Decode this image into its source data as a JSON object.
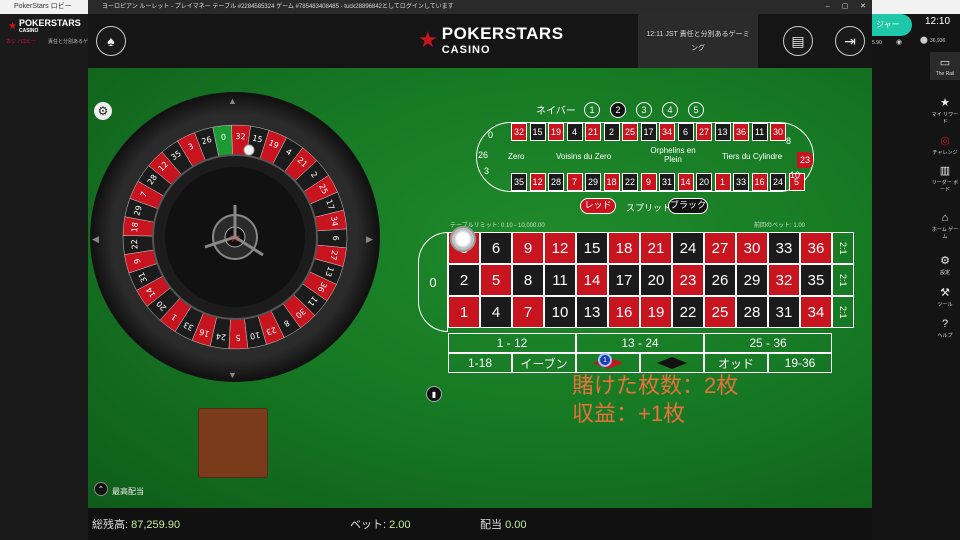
{
  "outer_app": {
    "title": "PokerStars ロビー",
    "logo": "POKERSTARS",
    "logo_sub": "CASINO",
    "tabs": [
      "カジノロビー",
      "責任と分別あるゲーム"
    ],
    "clock": "12:10",
    "balance_small": "36,936",
    "amount_small": "5.90",
    "join_button": "ジャー"
  },
  "game_window": {
    "title": "ヨーロピアン ルーレット - プレイマネー テーブル #2284585324 ゲーム #785483408485 - tuck28896842としてログインしています",
    "header": {
      "logo": "POKERSTARS",
      "logo_sub": "CASINO",
      "responsible_gaming": "12:11 JST 責任と分別あるゲーミング",
      "left_icon": "spade-icon",
      "cashier_icon": "cashier-icon",
      "exit_icon": "exit-icon"
    },
    "wheel": {
      "numbers": [
        0,
        32,
        15,
        19,
        4,
        21,
        2,
        25,
        17,
        34,
        6,
        27,
        13,
        36,
        11,
        30,
        8,
        23,
        10,
        5,
        24,
        16,
        33,
        1,
        20,
        14,
        31,
        9,
        22,
        18,
        29,
        7,
        28,
        12,
        35,
        3,
        26
      ],
      "red_numbers": [
        32,
        19,
        21,
        25,
        34,
        27,
        36,
        30,
        23,
        5,
        16,
        1,
        14,
        9,
        18,
        7,
        12,
        3
      ]
    },
    "racetrack": {
      "neighbors_label": "ネイバー",
      "neighbor_options": [
        "1",
        "2",
        "3",
        "4",
        "5"
      ],
      "selected_neighbor": "2",
      "top_row": [
        "32",
        "15",
        "19",
        "4",
        "21",
        "2",
        "25",
        "17",
        "34",
        "6",
        "27",
        "13",
        "36",
        "11",
        "30"
      ],
      "bottom_row": [
        "35",
        "12",
        "28",
        "7",
        "29",
        "18",
        "22",
        "9",
        "31",
        "14",
        "20",
        "1",
        "33",
        "16",
        "24",
        "5"
      ],
      "left_end": [
        "0",
        "26",
        "3"
      ],
      "right_end": [
        "8",
        "23",
        "10"
      ],
      "sections": [
        "Zero",
        "Voisins du Zero",
        "Orphelins en Plein",
        "Tiers du Cylindre"
      ],
      "red_button": "レッド",
      "split_label": "スプリット",
      "black_button": "ブラック"
    },
    "table": {
      "limit_label": "テーブルリミット: 0.10 - 10,000.00",
      "last_bet_label": "前回のベット: 1.00",
      "zero": "0",
      "rows": [
        [
          "3",
          "6",
          "9",
          "12",
          "15",
          "18",
          "21",
          "24",
          "27",
          "30",
          "33",
          "36"
        ],
        [
          "2",
          "5",
          "8",
          "11",
          "14",
          "17",
          "20",
          "23",
          "26",
          "29",
          "32",
          "35"
        ],
        [
          "1",
          "4",
          "7",
          "10",
          "13",
          "16",
          "19",
          "22",
          "25",
          "28",
          "31",
          "34"
        ]
      ],
      "columns": [
        "2:1",
        "2:1",
        "2:1"
      ],
      "dozens": [
        "1 - 12",
        "13 - 24",
        "25 - 36"
      ],
      "outside": [
        "1-18",
        "イーブン",
        "",
        "",
        "オッド",
        "19-36"
      ],
      "chip_value": "1"
    },
    "overlay": {
      "line1": "賭けた枚数：2枚",
      "line2": "収益：+1枚"
    },
    "max_bet_label": "最高配当",
    "footer": {
      "balance_label": "総残高:",
      "balance_value": "87,259.90",
      "bet_label": "ベット:",
      "bet_value": "2.00",
      "payout_label": "配当",
      "payout_value": "0.00"
    }
  },
  "sidebar": [
    {
      "label": "The Rail",
      "icon": "rail-icon"
    },
    {
      "label": "マイ リワード",
      "icon": "star-icon"
    },
    {
      "label": "チャレンジ",
      "icon": "target-icon"
    },
    {
      "label": "リーダー ボード",
      "icon": "chart-icon"
    },
    {
      "label": "ホーム ゲーム",
      "icon": "home-icon"
    },
    {
      "label": "設定",
      "icon": "gear-icon"
    },
    {
      "label": "ツール",
      "icon": "wrench-icon"
    },
    {
      "label": "ヘルプ",
      "icon": "help-icon"
    }
  ],
  "colors": {
    "felt": "#177a24",
    "red": "#c8141e",
    "black": "#1b1b1b",
    "overlay_text": "#e8703a"
  }
}
